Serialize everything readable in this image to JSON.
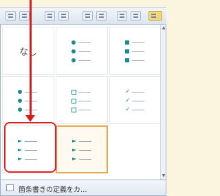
{
  "colors": {
    "accent": "#e0201e",
    "bullet": "#1c8c8a",
    "hover_border": "#e6a84a"
  },
  "bullet_library": {
    "cells": [
      {
        "label": "なし",
        "style": "none"
      },
      {
        "style": "disc"
      },
      {
        "style": "square"
      },
      {
        "style": "disc"
      },
      {
        "style": "hollow-square"
      },
      {
        "style": "checkmark"
      },
      {
        "style": "arrow"
      },
      {
        "style": "arrow"
      }
    ]
  },
  "footer": {
    "label": "箇条書きの定義をカ..."
  },
  "annotation": {
    "type": "red-arrow-and-box"
  }
}
